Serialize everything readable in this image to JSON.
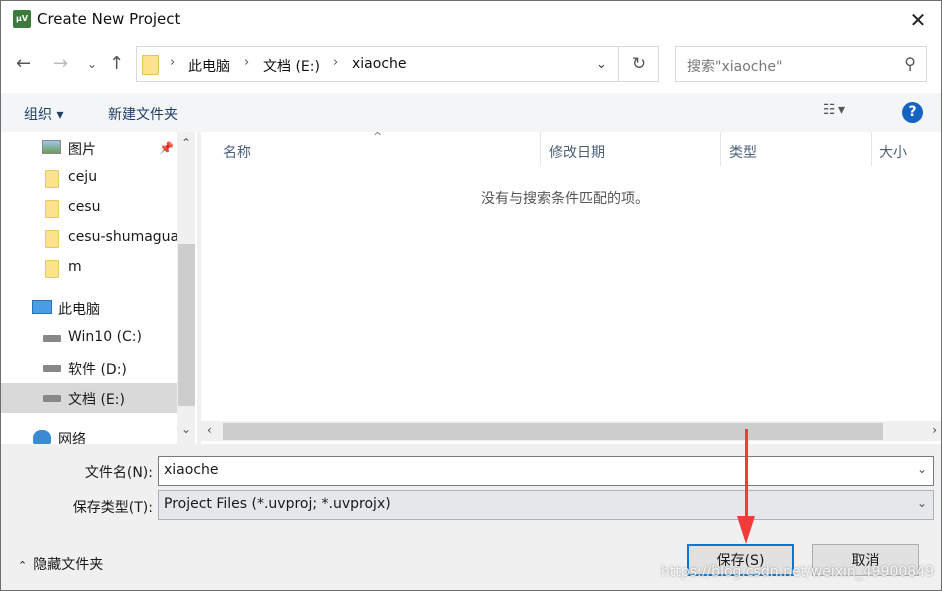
{
  "window": {
    "title": "Create New Project",
    "app_icon": "uvision-icon"
  },
  "nav": {
    "back": "←",
    "forward": "→",
    "recent": "⌄",
    "up": "↑",
    "breadcrumbs": [
      "此电脑",
      "文档 (E:)",
      "xiaoche"
    ],
    "search_placeholder": "搜索\"xiaoche\""
  },
  "toolbar": {
    "organize": "组织 ▾",
    "new_folder": "新建文件夹"
  },
  "sidebar": {
    "items": [
      {
        "label": "图片",
        "icon": "pictures-icon",
        "pinned": true
      },
      {
        "label": "ceju",
        "icon": "folder-icon"
      },
      {
        "label": "cesu",
        "icon": "folder-icon"
      },
      {
        "label": "cesu-shumaguan",
        "icon": "folder-icon"
      },
      {
        "label": "m",
        "icon": "folder-icon"
      },
      {
        "label": "此电脑",
        "icon": "computer-icon"
      },
      {
        "label": "Win10 (C:)",
        "icon": "drive-icon"
      },
      {
        "label": "软件 (D:)",
        "icon": "drive-icon"
      },
      {
        "label": "文档 (E:)",
        "icon": "drive-icon",
        "selected": true
      },
      {
        "label": "网络",
        "icon": "network-icon"
      }
    ]
  },
  "list": {
    "columns": [
      "名称",
      "修改日期",
      "类型",
      "大小"
    ],
    "empty_message": "没有与搜索条件匹配的项。"
  },
  "form": {
    "filename_label": "文件名(N):",
    "filename_value": "xiaoche",
    "type_label": "保存类型(T):",
    "type_value": "Project Files (*.uvproj; *.uvprojx)"
  },
  "footer": {
    "hide_folders": "隐藏文件夹",
    "save": "保存(S)",
    "cancel": "取消"
  },
  "watermark": "https://blog.csdn.net/weixin_49900849"
}
